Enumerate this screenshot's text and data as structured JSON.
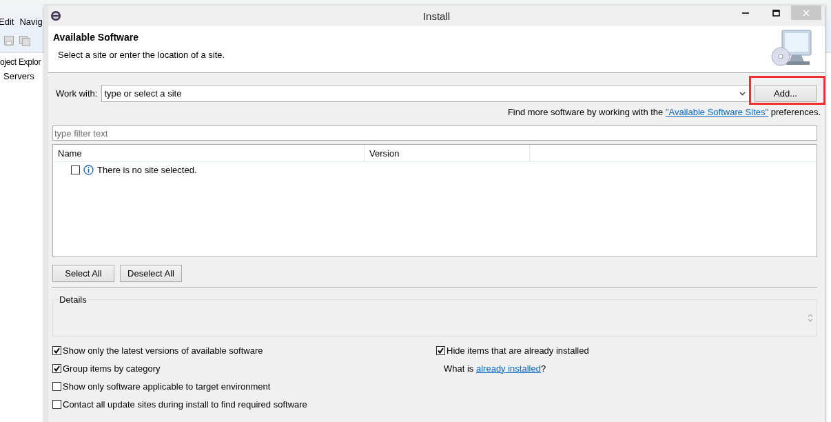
{
  "ide": {
    "menu": [
      "Edit",
      "Navig"
    ],
    "view_title": "oject Explor",
    "tree_items": [
      "Servers"
    ]
  },
  "window": {
    "title": "Install"
  },
  "header": {
    "title": "Available Software",
    "subtitle": "Select a site or enter the location of a site."
  },
  "work_with": {
    "label": "Work with:",
    "placeholder": "type or select a site",
    "add_button": {
      "label": "Add...",
      "highlighted": true
    }
  },
  "more_software": {
    "text_before": "Find more software by working with the ",
    "link": "\"Available Software Sites\"",
    "text_after": " preferences."
  },
  "filter": {
    "placeholder": "type filter text"
  },
  "table": {
    "columns": [
      "Name",
      "Version"
    ],
    "rows": [
      {
        "kind": "info",
        "checked": false,
        "text": "There is no site selected."
      }
    ]
  },
  "buttons": [
    "Select All",
    "Deselect All"
  ],
  "details": {
    "label": "Details"
  },
  "options_left": [
    {
      "label": "Show only the latest versions of available software",
      "checked": true
    },
    {
      "label": "Group items by category",
      "checked": true
    },
    {
      "label": "Show only software applicable to target environment",
      "checked": false
    },
    {
      "label": "Contact all update sites during install to find required software",
      "checked": false
    }
  ],
  "options_right": [
    {
      "label": "Hide items that are already installed",
      "checked": true
    }
  ],
  "installed_link": {
    "text_before": "What is ",
    "link": "already installed",
    "text_after": "?"
  }
}
